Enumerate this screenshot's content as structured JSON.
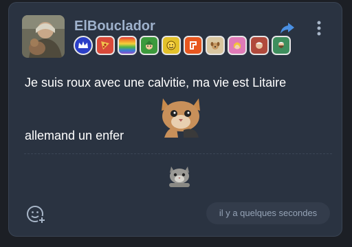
{
  "post": {
    "author": "ElBouclador",
    "text_line1": "Je suis roux avec une calvitie, ma vie est Litaire",
    "text_line2": "allemand un enfer",
    "timestamp": "il y a quelques secondes"
  },
  "badges": [
    {
      "name": "crown-badge-icon",
      "color": "#2b3fc7"
    },
    {
      "name": "pizza-badge-icon",
      "color": "#d94a3a"
    },
    {
      "name": "rainbow-badge-icon",
      "color": "#e4c431"
    },
    {
      "name": "elf-badge-icon",
      "color": "#3c9a3c"
    },
    {
      "name": "smiley-badge-icon",
      "color": "#e3c12a"
    },
    {
      "name": "logo-badge-icon",
      "color": "#e8571f"
    },
    {
      "name": "dog-badge-icon",
      "color": "#d9c6a0"
    },
    {
      "name": "princess-badge-icon",
      "color": "#e07ab7"
    },
    {
      "name": "man-badge-icon",
      "color": "#b04a3c"
    },
    {
      "name": "bearded-man-badge-icon",
      "color": "#3e8e5d"
    }
  ],
  "icons": {
    "share": "share-arrow-icon",
    "more": "kebab-menu-icon",
    "react": "add-reaction-icon"
  },
  "colors": {
    "card_bg": "#2a3341",
    "username": "#9fb2cc",
    "accent_share": "#4a90e2"
  }
}
